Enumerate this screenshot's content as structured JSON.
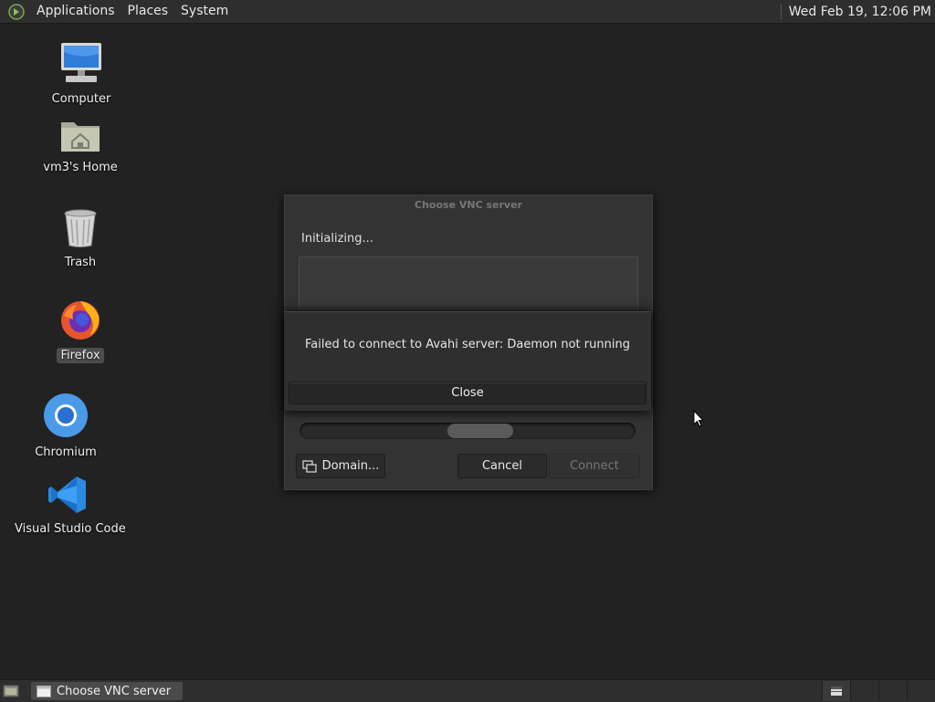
{
  "top_panel": {
    "menus": [
      "Applications",
      "Places",
      "System"
    ],
    "clock": "Wed Feb 19, 12:06 PM"
  },
  "desktop": {
    "icons": [
      {
        "label": "Computer",
        "icon": "computer-icon"
      },
      {
        "label": "vm3's Home",
        "icon": "home-folder-icon"
      },
      {
        "label": "Trash",
        "icon": "trash-icon"
      },
      {
        "label": "Firefox",
        "icon": "firefox-icon",
        "selected": true
      },
      {
        "label": "Chromium",
        "icon": "chromium-icon"
      },
      {
        "label": "Visual Studio Code",
        "icon": "vscode-icon"
      }
    ]
  },
  "vnc_dialog": {
    "title": "Choose VNC server",
    "status": "Initializing...",
    "buttons": {
      "domain": "Domain...",
      "cancel": "Cancel",
      "connect": "Connect"
    }
  },
  "alert": {
    "message": "Failed to connect to Avahi server: Daemon not running",
    "close_label": "Close"
  },
  "taskbar": {
    "task_label": "Choose VNC server"
  },
  "colors": {
    "desktop_bg": "#222222",
    "panel_bg": "#2e2e2e",
    "dialog_bg": "#333333"
  }
}
